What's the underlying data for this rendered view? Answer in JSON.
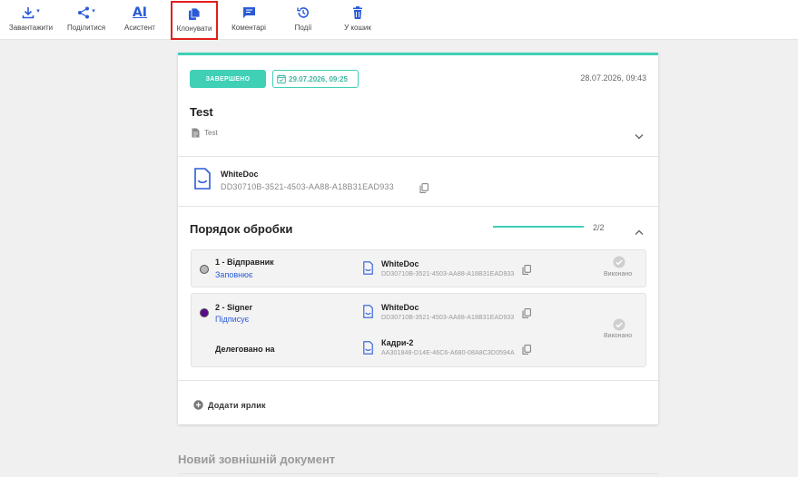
{
  "toolbar": {
    "download": "Завантажити",
    "share": "Поділитися",
    "assistant": "Асистент",
    "assistant_icon_text": "AI",
    "copy": "Клонувати",
    "comments": "Коментарі",
    "events": "Події",
    "trash": "У кошик"
  },
  "card": {
    "status": "ЗАВЕРШЕНО",
    "deadline": "29.07.2026, 09:25",
    "created": "28.07.2026, 09:43",
    "title": "Test",
    "subtitle": "Test",
    "main_doc": {
      "name": "WhiteDoc",
      "id": "DD30710B-3521-4503-AA88-A18B31EAD933"
    },
    "order": {
      "title": "Порядок обробки",
      "progress_text": "2/2",
      "progress_fraction": 1.0
    },
    "steps": [
      {
        "name": "1 - Відправник",
        "action": "Заповнює",
        "dot_color": "#b8b8b8",
        "doc_name": "WhiteDoc",
        "doc_id": "DD30710B-3521-4503-AA88-A18B31EAD933",
        "done": "Виконано"
      },
      {
        "name": "2 - Signer",
        "action": "Підписує",
        "dot_color": "#5a0a8c",
        "doc_name": "WhiteDoc",
        "doc_id": "DD30710B-3521-4503-AA88-A18B31EAD933",
        "done": "Виконано",
        "delegated_label": "Делеговано на",
        "delegated_doc_name": "Кадри-2",
        "delegated_doc_id": "AA301848-D14E-46C6-A680-08A8C3D0594A"
      }
    ],
    "add_label": "Додати ярлик"
  },
  "new_doc_title": "Новий зовнішній документ",
  "colors": {
    "accent": "#3fd0b6",
    "link": "#2a5bd7",
    "highlight": "#e0201b"
  }
}
